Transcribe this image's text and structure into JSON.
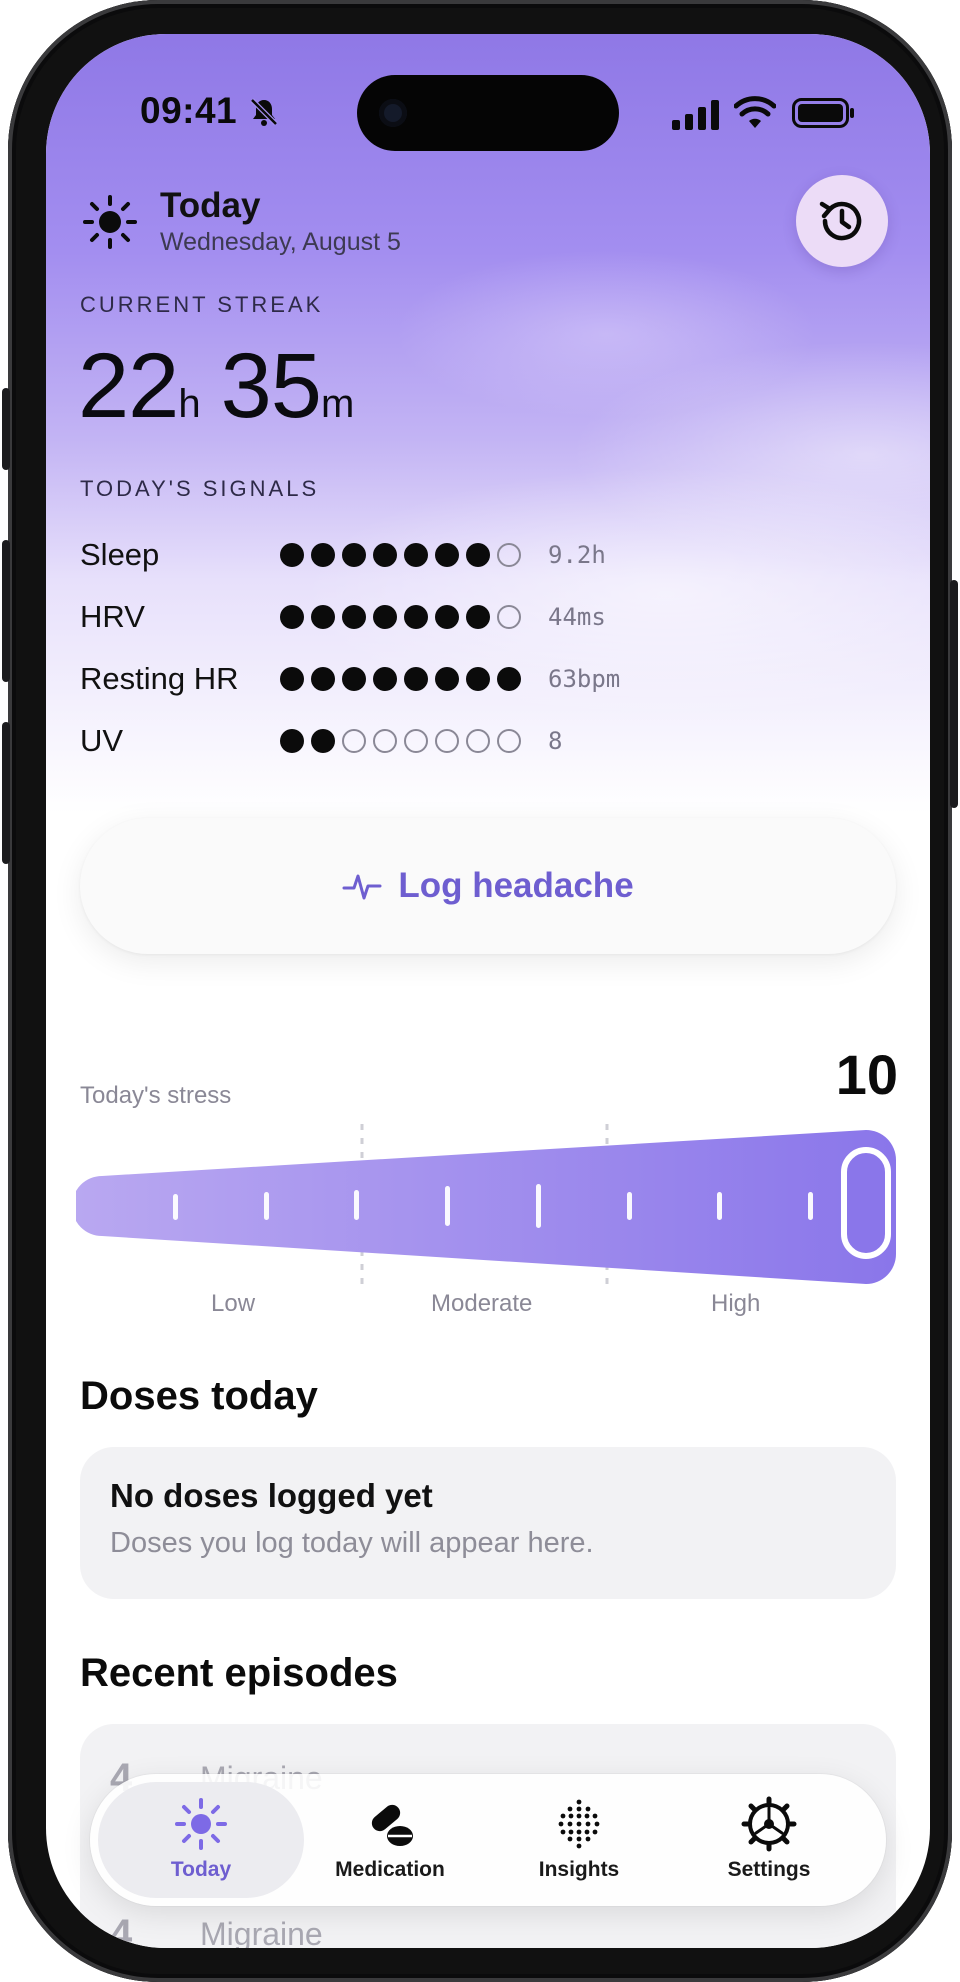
{
  "status_bar": {
    "time": "09:41"
  },
  "header": {
    "title": "Today",
    "date": "Wednesday, August 5"
  },
  "streak": {
    "label": "CURRENT STREAK",
    "hours": "22",
    "hours_unit": "h",
    "minutes": "35",
    "minutes_unit": "m"
  },
  "signals": {
    "label": "TODAY'S SIGNALS",
    "items": [
      {
        "name": "Sleep",
        "filled": 7,
        "total": 8,
        "value": "9.2h"
      },
      {
        "name": "HRV",
        "filled": 7,
        "total": 8,
        "value": "44ms"
      },
      {
        "name": "Resting HR",
        "filled": 8,
        "total": 8,
        "value": "63bpm"
      },
      {
        "name": "UV",
        "filled": 2,
        "total": 8,
        "value": "8"
      }
    ]
  },
  "log_button": {
    "label": "Log headache"
  },
  "stress": {
    "label": "Today's stress",
    "value": "10",
    "level": 1.0,
    "ticks": [
      "Low",
      "Moderate",
      "High"
    ]
  },
  "doses": {
    "title": "Doses today",
    "empty_title": "No doses logged yet",
    "empty_sub": "Doses you log today will appear here."
  },
  "episodes": {
    "title": "Recent episodes",
    "items": [
      {
        "severity": "4",
        "type": "Migraine"
      },
      {
        "severity": "4",
        "type": "Migraine"
      }
    ]
  },
  "tabbar": {
    "active": "Today",
    "tabs": [
      {
        "label": "Today",
        "icon": "sun-icon"
      },
      {
        "label": "Medication",
        "icon": "pills-icon"
      },
      {
        "label": "Insights",
        "icon": "dots-grid-icon"
      },
      {
        "label": "Settings",
        "icon": "gear-icon"
      }
    ]
  },
  "colors": {
    "accent": "#6e5ed0",
    "hero_top": "#8f78e6",
    "slider_start": "#b9a8f1",
    "slider_end": "#8a76ea"
  }
}
